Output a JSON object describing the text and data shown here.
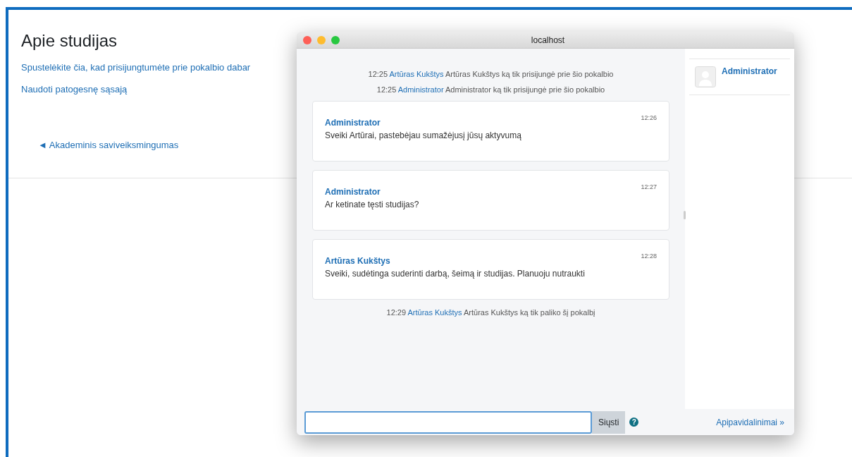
{
  "page": {
    "title": "Apie studijas",
    "links": [
      "Spustelėkite čia, kad prisijungtumėte prie pokalbio dabar",
      "Naudoti patogesnę sąsają"
    ],
    "back_link": {
      "arrow": "◄",
      "label": "Akademinis saviveiksmingumas"
    }
  },
  "chat_window": {
    "title": "localhost",
    "feed": [
      {
        "kind": "event",
        "time": "12:25",
        "user": "Artūras Kukštys",
        "text": "Artūras Kukštys ką tik prisijungė prie šio pokalbio"
      },
      {
        "kind": "event",
        "time": "12:25",
        "user": "Administrator",
        "text": "Administrator   ką tik prisijungė prie šio pokalbio"
      },
      {
        "kind": "message",
        "author": "Administrator",
        "time": "12:26",
        "text": "Sveiki Artūrai, pastebėjau sumažėjusį jūsų aktyvumą"
      },
      {
        "kind": "message",
        "author": "Administrator",
        "time": "12:27",
        "text": "Ar ketinate tęsti studijas?"
      },
      {
        "kind": "message",
        "author": "Artūras Kukštys",
        "time": "12:28",
        "text": "Sveiki, sudėtinga suderinti darbą, šeimą ir studijas. Planuoju nutraukti"
      },
      {
        "kind": "event",
        "time": "12:29",
        "user": "Artūras Kukštys",
        "text": "Artūras Kukštys ką tik paliko šį pokalbį"
      }
    ],
    "users": [
      {
        "name": "Administrator"
      }
    ],
    "send_button": "Siųsti",
    "help": "?",
    "themes_link": "Apipavidalinimai »"
  }
}
